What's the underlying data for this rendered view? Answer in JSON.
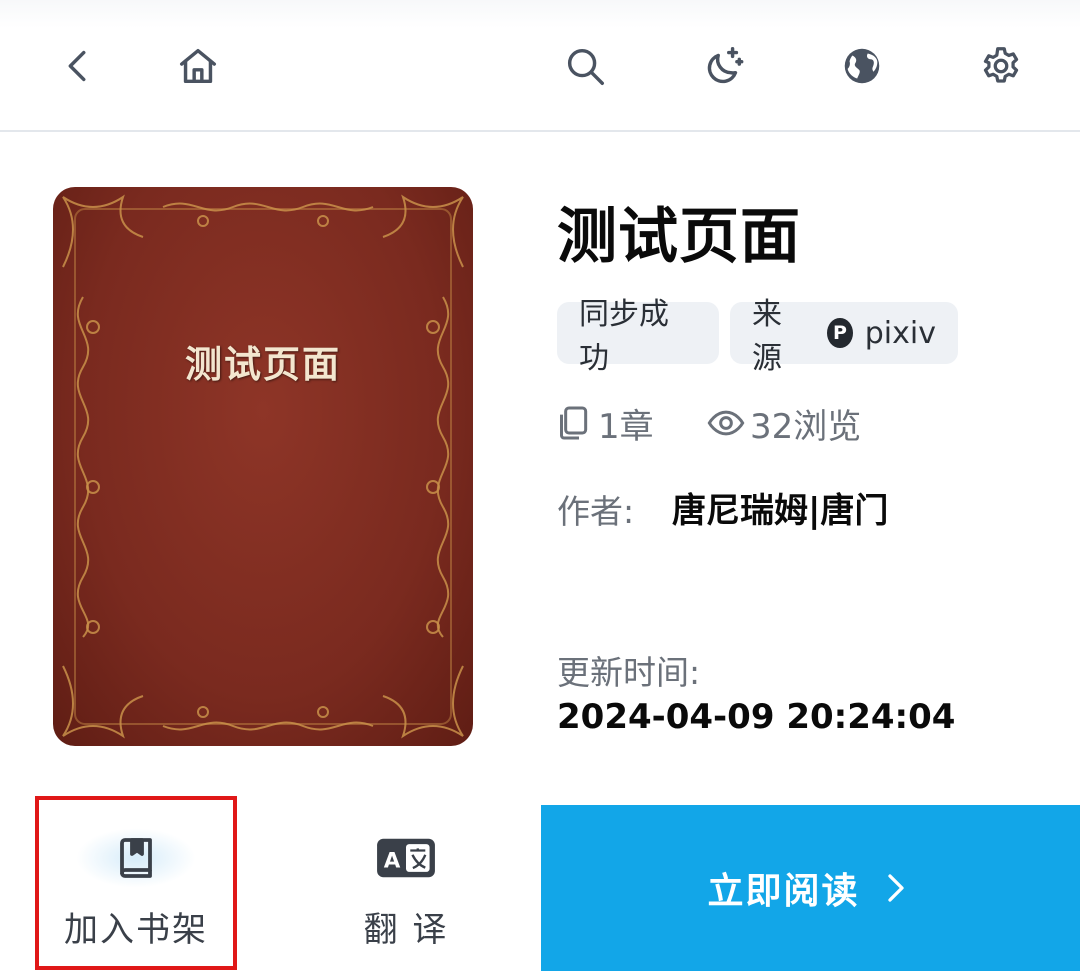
{
  "topbar": {
    "icons": [
      "back-icon",
      "home-icon",
      "search-icon",
      "night-mode-icon",
      "globe-icon",
      "settings-icon"
    ]
  },
  "book": {
    "cover_title": "测试页面",
    "title": "测试页面",
    "sync_status": "同步成功",
    "source_label": "来源",
    "source_badge": "P",
    "source_name": "pixiv",
    "chapters": "1章",
    "views": "32浏览",
    "author_label": "作者:",
    "author": "唐尼瑞姆|唐门",
    "update_label": "更新时间:",
    "update_time": "2024-04-09 20:24:04"
  },
  "actions": {
    "bookshelf_label": "加入书架",
    "translate_label": "翻 译",
    "read_label": "立即阅读"
  },
  "colors": {
    "accent": "#12a6e8",
    "cover": "#7a2a1f",
    "highlight": "#e01818"
  }
}
